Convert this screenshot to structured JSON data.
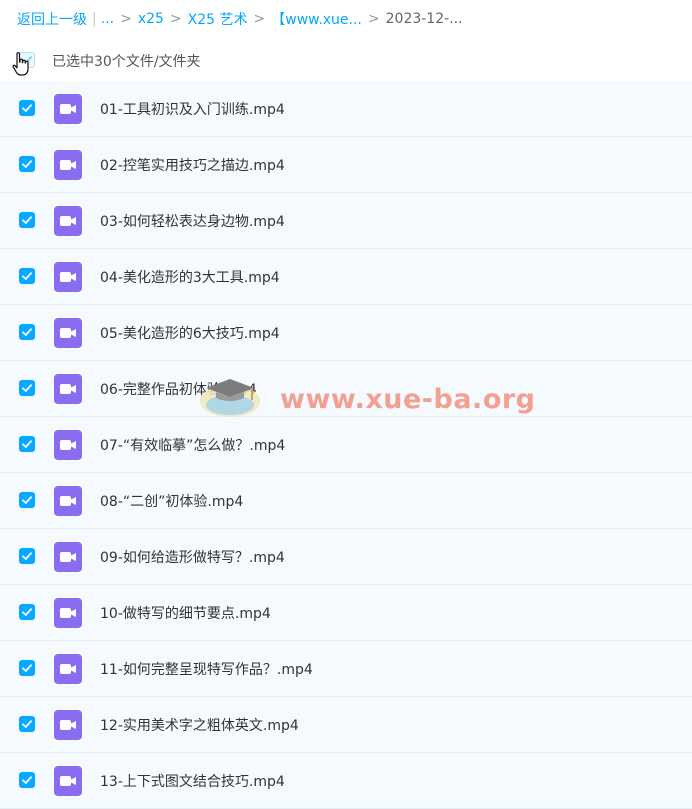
{
  "breadcrumb": {
    "back": "返回上一级",
    "pipe": "|",
    "ellipsis": "...",
    "sep": ">",
    "items": [
      "x25",
      "X25 艺术",
      "【www.xue...",
      "2023-12-..."
    ]
  },
  "selection": {
    "label": "已选中30个文件/文件夹"
  },
  "files": [
    {
      "name": "01-工具初识及入门训练.mp4"
    },
    {
      "name": "02-控笔实用技巧之描边.mp4"
    },
    {
      "name": "03-如何轻松表达身边物.mp4"
    },
    {
      "name": "04-美化造形的3大工具.mp4"
    },
    {
      "name": "05-美化造形的6大技巧.mp4"
    },
    {
      "name": "06-完整作品初体验.mp4"
    },
    {
      "name": "07-“有效临摹”怎么做？.mp4"
    },
    {
      "name": "08-“二创”初体验.mp4"
    },
    {
      "name": "09-如何给造形做特写？.mp4"
    },
    {
      "name": "10-做特写的细节要点.mp4"
    },
    {
      "name": "11-如何完整呈现特写作品？.mp4"
    },
    {
      "name": "12-实用美术字之粗体英文.mp4"
    },
    {
      "name": "13-上下式图文结合技巧.mp4"
    }
  ],
  "watermark": "www.xue-ba.org",
  "colors": {
    "accent": "#06a7ff",
    "video_icon": "#8a6cf0",
    "row_bg": "#f5faff"
  },
  "icons": {
    "file": "video-file-icon",
    "check": "checkmark-icon"
  }
}
